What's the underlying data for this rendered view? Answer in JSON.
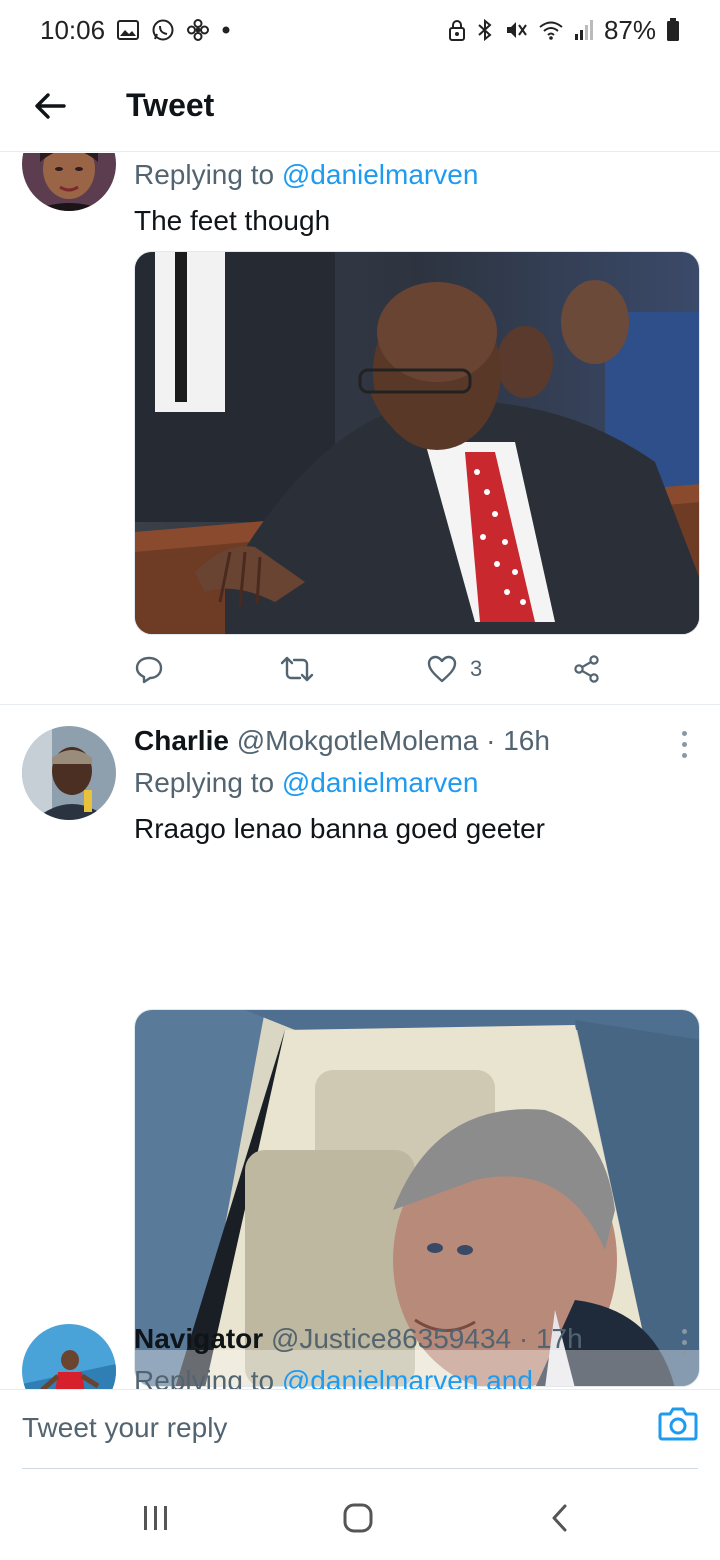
{
  "status_bar": {
    "time": "10:06",
    "battery": "87%",
    "left_icons": [
      "gallery-icon",
      "whatsapp-icon",
      "fan-icon",
      "dot-icon"
    ],
    "right_icons": [
      "lock-icon",
      "bluetooth-icon",
      "mute-icon",
      "wifi-icon",
      "signal-icon",
      "battery-icon"
    ]
  },
  "header": {
    "title": "Tweet",
    "back_icon": "arrow-left-icon"
  },
  "tweets": [
    {
      "name": "",
      "handle": "",
      "time": "",
      "replying_prefix": "Replying to ",
      "replying_to": "@danielmarven",
      "text": "The feet though",
      "media": "photo: older man in suit and red polka-dot tie seated in courtroom",
      "likes": "3"
    },
    {
      "name": "Charlie",
      "handle": "@MokgotleMolema",
      "time": "· 16h",
      "replying_prefix": "Replying to ",
      "replying_to": "@danielmarven",
      "text": "Rraago lenao banna goed geeter",
      "media": "photo: elderly man looking out of a car window",
      "likes": ""
    },
    {
      "name": "Navigator",
      "handle": "@Justice86359434",
      "time": "· 17h",
      "replying_prefix": "Replying to ",
      "replying_to": "@danielmarven and"
    }
  ],
  "composer": {
    "placeholder": "Tweet your reply"
  },
  "colors": {
    "accent": "#1d9bf0",
    "secondary_text": "#536471",
    "primary_text": "#0f1419",
    "divider": "#e6ecf0"
  }
}
